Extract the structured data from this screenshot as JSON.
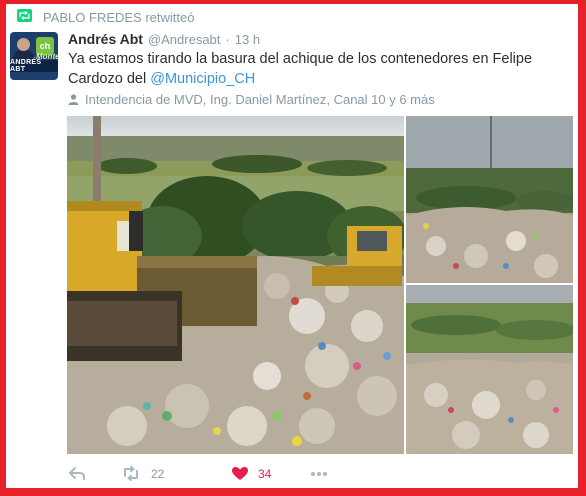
{
  "retweet_banner": {
    "text": "PABLO FREDES retwitteó"
  },
  "author": {
    "name": "Andrés Abt",
    "handle": "@Andresabt",
    "separator": "·",
    "time": "13 h"
  },
  "avatar": {
    "badge": "ch",
    "slogan": "Monte",
    "band": "ANDRÉS ABT"
  },
  "tweet": {
    "text_before": "Ya estamos tirando la basura del achique de los contenedores en Felipe Cardozo del ",
    "mention": "@Municipio_CH"
  },
  "location": {
    "text": "Intendencia de MVD, Ing. Daniel Martínez, Canal 10 y 6 más"
  },
  "actions": {
    "retweets": "22",
    "likes": "34"
  },
  "colors": {
    "frame": "#e8202a",
    "accent": "#3b94d9",
    "retweet": "#19cf86",
    "like": "#e81c4f",
    "muted": "#8899a6"
  },
  "icons": [
    "retweet-icon",
    "location-pin-icon",
    "reply-icon",
    "heart-icon",
    "more-icon"
  ]
}
